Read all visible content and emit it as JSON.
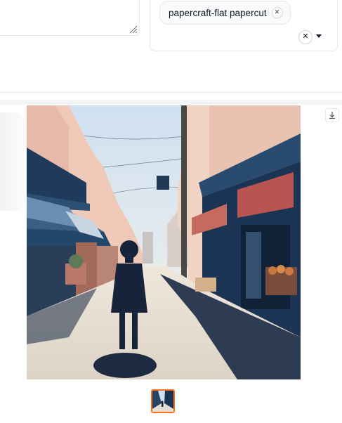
{
  "style_selector": {
    "selected_chip_label": "papercraft-flat papercut"
  },
  "gallery": {
    "image_alt": "",
    "thumbnail_count": 1
  },
  "colors": {
    "accent": "#f97316",
    "sky": "#e9f0f7",
    "shadow": "#1a2a45"
  }
}
